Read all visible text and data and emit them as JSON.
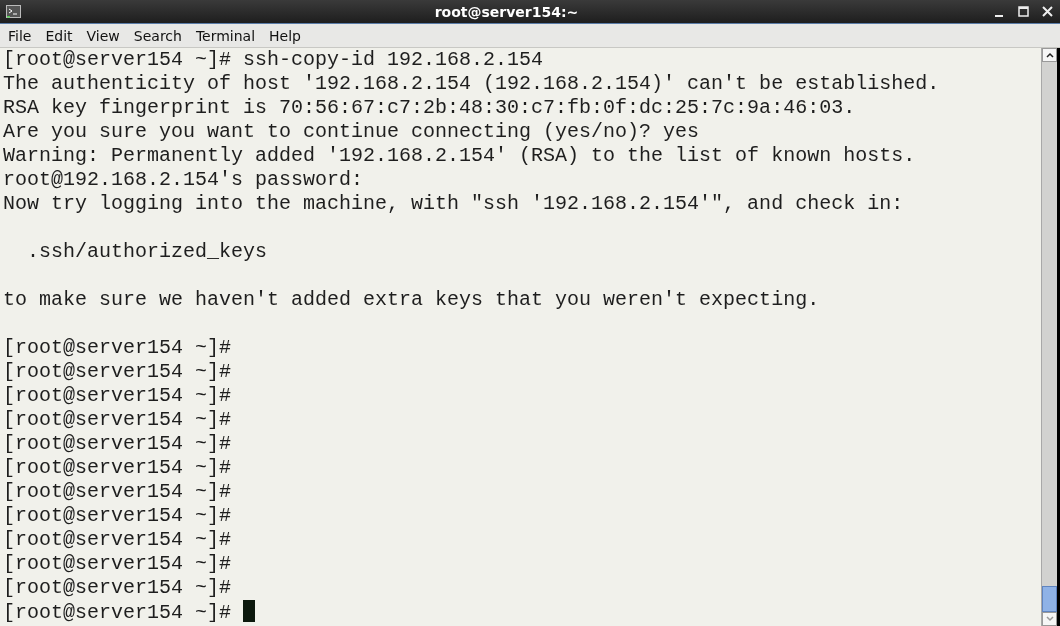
{
  "window": {
    "title": "root@server154:~"
  },
  "menu": [
    {
      "label": "File"
    },
    {
      "label": "Edit"
    },
    {
      "label": "View"
    },
    {
      "label": "Search"
    },
    {
      "label": "Terminal"
    },
    {
      "label": "Help"
    }
  ],
  "terminal": {
    "cursor_visible": true,
    "lines": [
      {
        "kind": "text",
        "text": "[root@server154 ~]# ssh-copy-id 192.168.2.154"
      },
      {
        "kind": "text",
        "text": "The authenticity of host '192.168.2.154 (192.168.2.154)' can't be established."
      },
      {
        "kind": "text",
        "text": "RSA key fingerprint is 70:56:67:c7:2b:48:30:c7:fb:0f:dc:25:7c:9a:46:03."
      },
      {
        "kind": "text",
        "text": "Are you sure you want to continue connecting (yes/no)? yes"
      },
      {
        "kind": "text",
        "text": "Warning: Permanently added '192.168.2.154' (RSA) to the list of known hosts."
      },
      {
        "kind": "text",
        "text": "root@192.168.2.154's password:"
      },
      {
        "kind": "text",
        "text": "Now try logging into the machine, with \"ssh '192.168.2.154'\", and check in:"
      },
      {
        "kind": "blank"
      },
      {
        "kind": "text",
        "text": "  .ssh/authorized_keys"
      },
      {
        "kind": "blank"
      },
      {
        "kind": "text",
        "text": "to make sure we haven't added extra keys that you weren't expecting."
      },
      {
        "kind": "blank"
      },
      {
        "kind": "text",
        "text": "[root@server154 ~]#"
      },
      {
        "kind": "text",
        "text": "[root@server154 ~]#"
      },
      {
        "kind": "text",
        "text": "[root@server154 ~]#"
      },
      {
        "kind": "text",
        "text": "[root@server154 ~]#"
      },
      {
        "kind": "text",
        "text": "[root@server154 ~]#"
      },
      {
        "kind": "text",
        "text": "[root@server154 ~]#"
      },
      {
        "kind": "text",
        "text": "[root@server154 ~]#"
      },
      {
        "kind": "text",
        "text": "[root@server154 ~]#"
      },
      {
        "kind": "text",
        "text": "[root@server154 ~]#"
      },
      {
        "kind": "text",
        "text": "[root@server154 ~]#"
      },
      {
        "kind": "text",
        "text": "[root@server154 ~]#"
      },
      {
        "kind": "text",
        "text": "[root@server154 ~]#"
      }
    ]
  }
}
